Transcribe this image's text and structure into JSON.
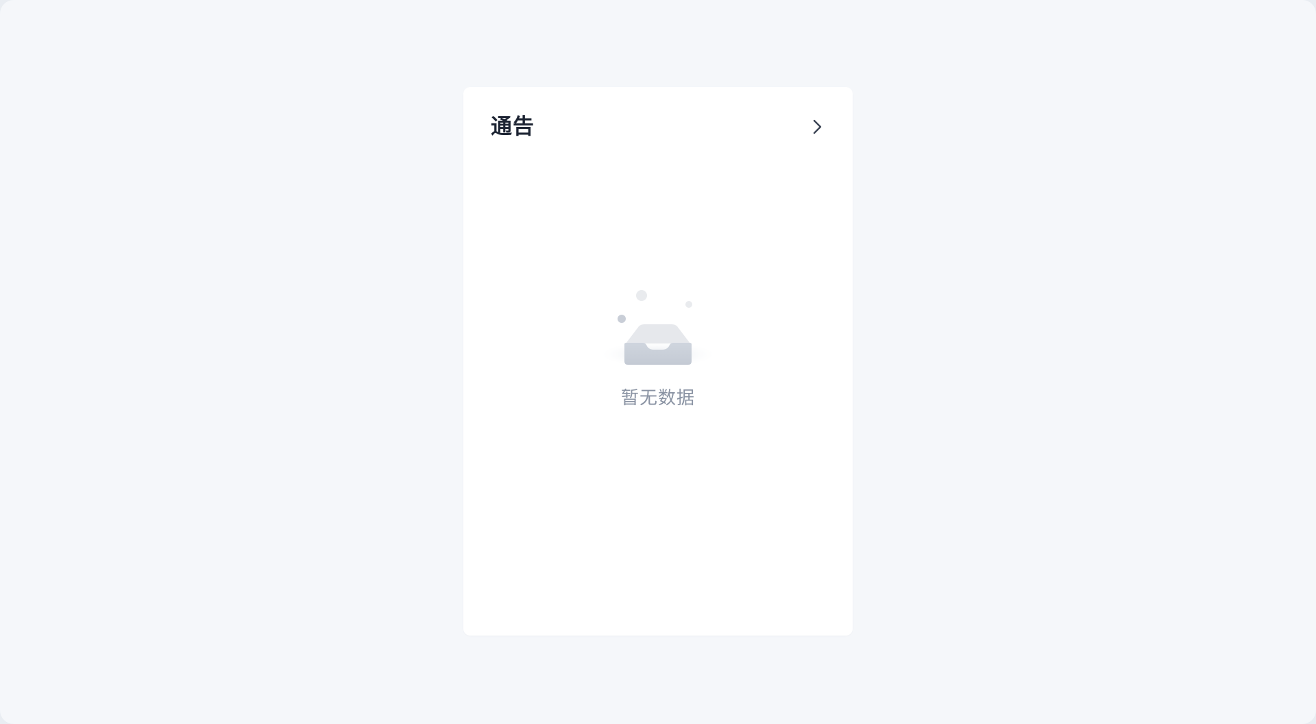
{
  "card": {
    "title": "通告",
    "more_icon": "chevron-right-icon"
  },
  "empty_state": {
    "icon": "empty-inbox-icon",
    "message": "暂无数据"
  },
  "colors": {
    "page_background": "#f5f7fa",
    "card_background": "#ffffff",
    "title_text": "#1d2433",
    "muted_text": "#8a93a3",
    "icon": "#3b4454"
  }
}
